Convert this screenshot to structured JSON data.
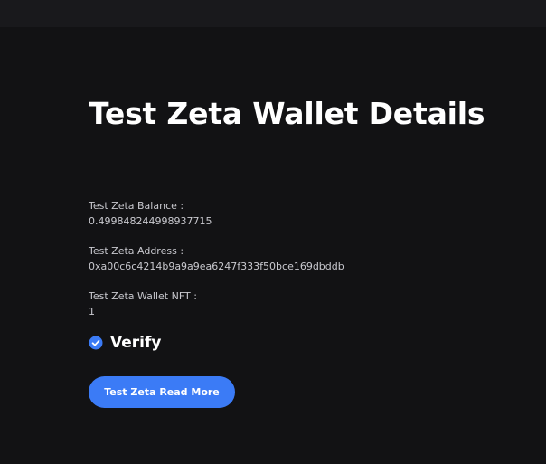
{
  "page": {
    "title": "Test Zeta Wallet Details"
  },
  "fields": [
    {
      "label": "Test Zeta Balance :",
      "value": "0.49984824499893771​5"
    },
    {
      "label": "Test Zeta Address :",
      "value": "0xa00c6c4214b9a9a9ea6247f333f50bce169dbddb"
    },
    {
      "label": "Test Zeta Wallet NFT :",
      "value": "1"
    }
  ],
  "verify": {
    "label": "Verify",
    "icon": "check-circle-icon",
    "icon_color": "#3b7bf6"
  },
  "cta": {
    "label": "Test Zeta Read More",
    "color": "#3b7bf6"
  }
}
